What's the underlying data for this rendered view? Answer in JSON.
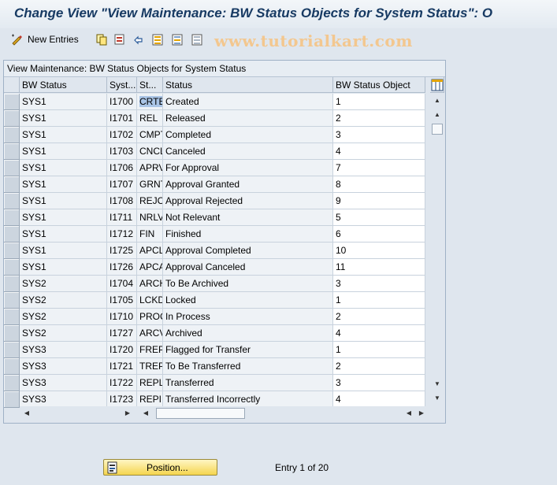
{
  "window": {
    "title": "Change View \"View Maintenance: BW Status Objects for System Status\": O"
  },
  "toolbar": {
    "new_entries_label": "New Entries",
    "icons": [
      "edit-pen-icon",
      "copy-icon",
      "delete-icon",
      "undo-icon",
      "select-all-icon",
      "select-block-icon",
      "deselect-all-icon"
    ]
  },
  "watermark": "www.tutorialkart.com",
  "table": {
    "title": "View Maintenance: BW Status Objects for System Status",
    "columns": [
      "BW Status",
      "Syst...",
      "St...",
      "Status",
      "BW Status Object"
    ],
    "rows": [
      {
        "bw": "SYS1",
        "sys": "I1700",
        "st": "CRTE",
        "status": "Created",
        "obj": "1"
      },
      {
        "bw": "SYS1",
        "sys": "I1701",
        "st": "REL",
        "status": "Released",
        "obj": "2"
      },
      {
        "bw": "SYS1",
        "sys": "I1702",
        "st": "CMPT",
        "status": "Completed",
        "obj": "3"
      },
      {
        "bw": "SYS1",
        "sys": "I1703",
        "st": "CNCL",
        "status": "Canceled",
        "obj": "4"
      },
      {
        "bw": "SYS1",
        "sys": "I1706",
        "st": "APRV",
        "status": "For Approval",
        "obj": "7"
      },
      {
        "bw": "SYS1",
        "sys": "I1707",
        "st": "GRNT",
        "status": "Approval Granted",
        "obj": "8"
      },
      {
        "bw": "SYS1",
        "sys": "I1708",
        "st": "REJC",
        "status": "Approval Rejected",
        "obj": "9"
      },
      {
        "bw": "SYS1",
        "sys": "I1711",
        "st": "NRLV",
        "status": "Not Relevant",
        "obj": "5"
      },
      {
        "bw": "SYS1",
        "sys": "I1712",
        "st": "FIN",
        "status": "Finished",
        "obj": "6"
      },
      {
        "bw": "SYS1",
        "sys": "I1725",
        "st": "APCL",
        "status": "Approval Completed",
        "obj": "10"
      },
      {
        "bw": "SYS1",
        "sys": "I1726",
        "st": "APCA",
        "status": "Approval Canceled",
        "obj": "11"
      },
      {
        "bw": "SYS2",
        "sys": "I1704",
        "st": "ARCH",
        "status": "To Be Archived",
        "obj": "3"
      },
      {
        "bw": "SYS2",
        "sys": "I1705",
        "st": "LCKD",
        "status": "Locked",
        "obj": "1"
      },
      {
        "bw": "SYS2",
        "sys": "I1710",
        "st": "PROC",
        "status": "In Process",
        "obj": "2"
      },
      {
        "bw": "SYS2",
        "sys": "I1727",
        "st": "ARCV",
        "status": "Archived",
        "obj": "4"
      },
      {
        "bw": "SYS3",
        "sys": "I1720",
        "st": "FREP",
        "status": "Flagged for Transfer",
        "obj": "1"
      },
      {
        "bw": "SYS3",
        "sys": "I1721",
        "st": "TREP",
        "status": "To Be Transferred",
        "obj": "2"
      },
      {
        "bw": "SYS3",
        "sys": "I1722",
        "st": "REPL",
        "status": "Transferred",
        "obj": "3"
      },
      {
        "bw": "SYS3",
        "sys": "I1723",
        "st": "REPI",
        "status": "Transferred Incorrectly",
        "obj": "4"
      }
    ]
  },
  "footer": {
    "position_label": "Position...",
    "entry_text": "Entry 1 of 20"
  },
  "colors": {
    "title": "#173a63",
    "background": "#dfe6ee",
    "highlight": "#a9c4e6",
    "position_button": "#f5d54e"
  }
}
